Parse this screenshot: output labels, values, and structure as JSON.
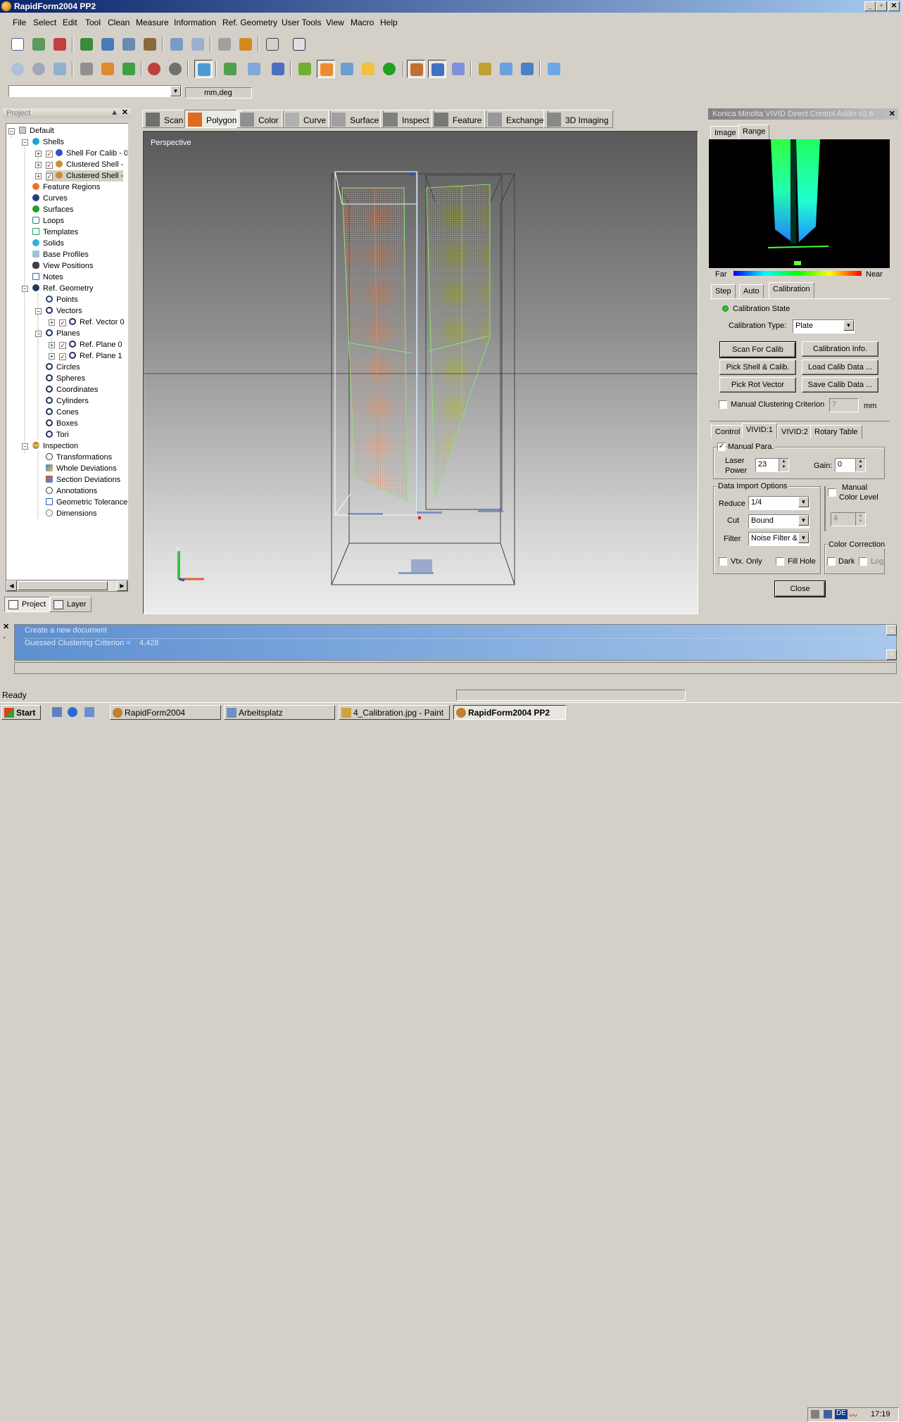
{
  "window": {
    "title": "RapidForm2004 PP2",
    "min": "_",
    "max": "▫",
    "close": "✕"
  },
  "menu": [
    "File",
    "Select",
    "Edit",
    "Tool",
    "Clean",
    "Measure",
    "Information",
    "Ref. Geometry",
    "User Tools",
    "View",
    "Macro",
    "Help"
  ],
  "units": "mm,deg",
  "project": {
    "header": "Project",
    "nodes": {
      "default": "Default",
      "shells": "Shells",
      "shell1": "Shell For Calib - 0",
      "shell2": "Clustered Shell -",
      "shell3": "Clustered Shell -",
      "feature_regions": "Feature Regions",
      "curves": "Curves",
      "surfaces": "Surfaces",
      "loops": "Loops",
      "templates": "Templates",
      "solids": "Solids",
      "base_profiles": "Base Profiles",
      "view_positions": "View Positions",
      "notes": "Notes",
      "ref_geometry": "Ref. Geometry",
      "points": "Points",
      "vectors": "Vectors",
      "ref_vector": "Ref. Vector 0",
      "planes": "Planes",
      "ref_plane0": "Ref. Plane 0",
      "ref_plane1": "Ref. Plane 1",
      "circles": "Circles",
      "spheres": "Spheres",
      "coordinates": "Coordinates",
      "cylinders": "Cylinders",
      "cones": "Cones",
      "boxes": "Boxes",
      "tori": "Tori",
      "inspection": "Inspection",
      "transformations": "Transformations",
      "whole_deviations": "Whole Deviations",
      "section_deviations": "Section Deviations",
      "annotations": "Annotations",
      "geometric_tolerance": "Geometric Tolerance",
      "dimensions": "Dimensions"
    },
    "tabs": {
      "project": "Project",
      "layer": "Layer"
    }
  },
  "viewtabs": [
    "Scan",
    "Polygon",
    "Color",
    "Curve",
    "Surface",
    "Inspect",
    "Feature",
    "Exchange",
    "3D Imaging"
  ],
  "viewport": {
    "label": "Perspective"
  },
  "dialog": {
    "title": "Konica Minolta VIVID Direct Control Addin v2.6",
    "image_tab": "Image",
    "range_tab": "Range",
    "far": "Far",
    "near": "Near",
    "subtabs": {
      "step": "Step",
      "auto": "Auto",
      "calibration": "Calibration"
    },
    "calib_state": "Calibration State",
    "calib_type_label": "Calibration Type:",
    "calib_type_value": "Plate",
    "buttons": {
      "scan_for_calib": "Scan For Calib",
      "calib_info": "Calibration Info.",
      "pick_shell": "Pick Shell & Calib.",
      "load_calib": "Load Calib Data ...",
      "pick_rot": "Pick Rot Vector",
      "save_calib": "Save Calib Data ...",
      "close": "Close"
    },
    "manual_clustering": "Manual Clustering Criterion",
    "clustering_value": "7",
    "clustering_unit": "mm",
    "lowertabs": {
      "control": "Control",
      "vivid1": "VIVID:1",
      "vivid2": "VIVID:2",
      "rotary": "Rotary Table"
    },
    "manual_para": "Manual Para.",
    "laser_power_l1": "Laser",
    "laser_power_l2": "Power",
    "laser_power_value": "23",
    "gain_label": "Gain:",
    "gain_value": "0",
    "data_import": "Data Import Options",
    "reduce_label": "Reduce",
    "reduce_value": "1/4",
    "cut_label": "Cut",
    "cut_value": "Bound",
    "filter_label": "Filter",
    "filter_value": "Noise Filter &",
    "manual_color_l1": "Manual",
    "manual_color_l2": "Color Level",
    "color_level_value": "4",
    "color_correction": "Color Correction",
    "dark": "Dark",
    "log": "Log",
    "vtx_only": "Vtx. Only",
    "fill_hole": "Fill Hole"
  },
  "output": {
    "line1": "Create a new document",
    "line2_label": "Guessed Clustering Criterion =",
    "line2_value": "4.428"
  },
  "status": "Ready",
  "taskbar": {
    "start": "Start",
    "tasks": [
      "RapidForm2004",
      "Arbeitsplatz",
      "4_Calibration.jpg - Paint",
      "RapidForm2004 PP2"
    ],
    "lang": "DE",
    "time": "17:19"
  },
  "colors": {
    "titlebar": "#0a246a",
    "face": "#d4d0c8",
    "output": "#5d8fd0"
  }
}
